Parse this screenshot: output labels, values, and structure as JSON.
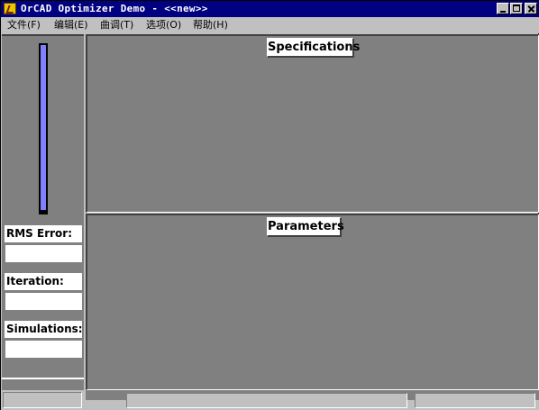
{
  "window": {
    "title": "OrCAD Optimizer Demo - <<new>>",
    "controls": [
      "minimize-icon",
      "maximize-icon",
      "close-icon"
    ]
  },
  "menu": {
    "items": [
      {
        "label": "文件(F)"
      },
      {
        "label": "编辑(E)"
      },
      {
        "label": "曲调(T)"
      },
      {
        "label": "选项(O)"
      },
      {
        "label": "帮助(H)"
      }
    ]
  },
  "left_panel": {
    "progress": 1.0,
    "rms_error": {
      "label": "RMS Error:",
      "value": ""
    },
    "iteration": {
      "label": "Iteration:",
      "value": ""
    },
    "simulations": {
      "label": "Simulations:",
      "value": ""
    }
  },
  "panes": {
    "specifications": {
      "title": "Specifications"
    },
    "parameters": {
      "title": "Parameters"
    }
  },
  "status_bar": {
    "left": "",
    "panel1": "",
    "panel2": ""
  },
  "colors": {
    "titlebar": "#000080",
    "face": "#c0c0c0",
    "pane": "#808080",
    "progress_fill": "#8080ff"
  }
}
